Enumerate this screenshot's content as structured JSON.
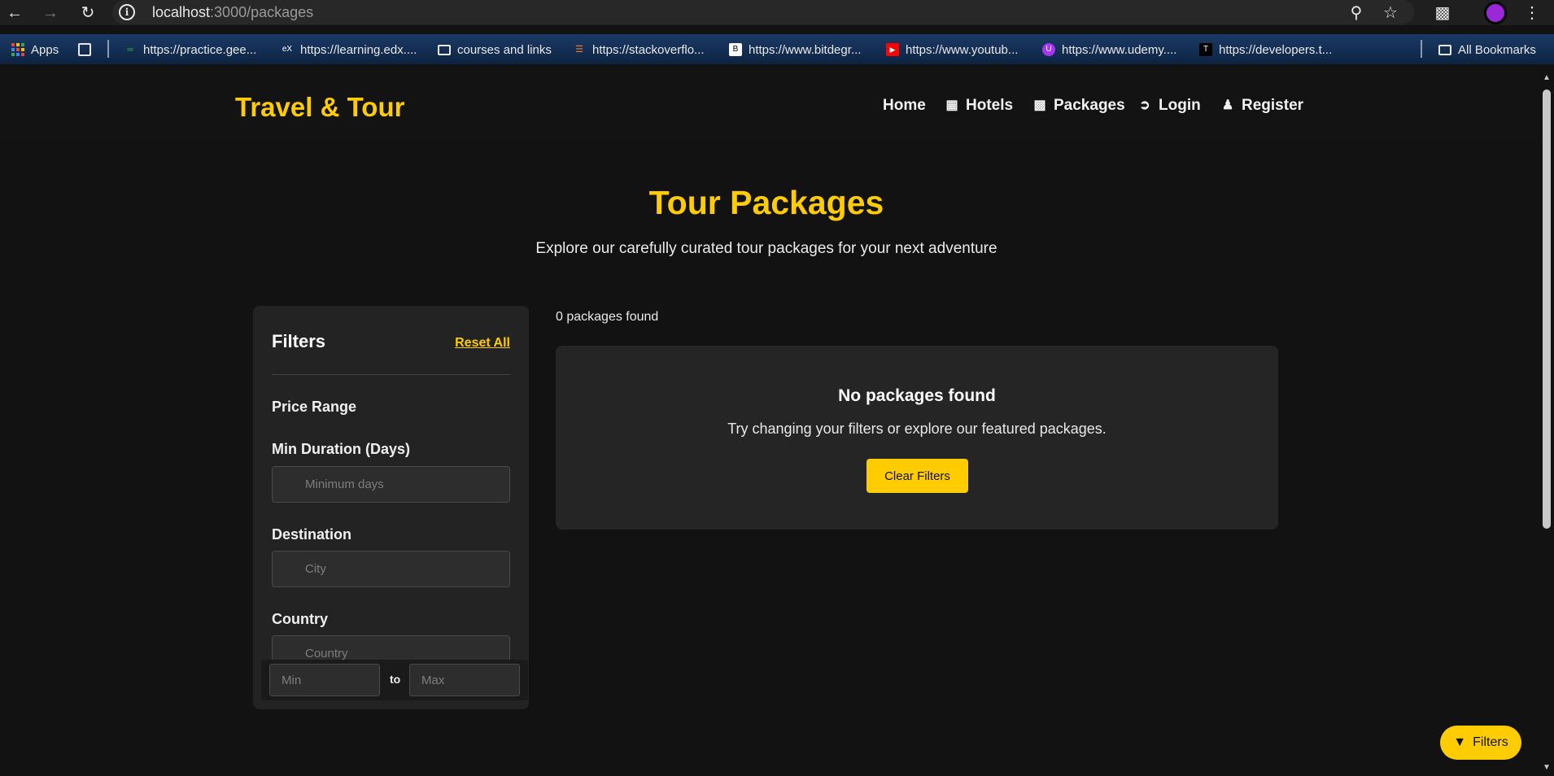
{
  "browser": {
    "url_host": "localhost",
    "url_path": ":3000/packages",
    "bookmarks": [
      {
        "label": "Apps"
      },
      {
        "label": "https://practice.gee..."
      },
      {
        "label": "https://learning.edx...."
      },
      {
        "label": "courses and links"
      },
      {
        "label": "https://stackoverflo..."
      },
      {
        "label": "https://www.bitdegr..."
      },
      {
        "label": "https://www.youtub..."
      },
      {
        "label": "https://www.udemy...."
      },
      {
        "label": "https://developers.t..."
      },
      {
        "label": "All Bookmarks"
      }
    ]
  },
  "site": {
    "brand": "Travel & Tour",
    "nav": [
      {
        "label": "Home",
        "icon": "none"
      },
      {
        "label": "Hotels",
        "icon": "building-icon"
      },
      {
        "label": "Packages",
        "icon": "suitcase-icon"
      },
      {
        "label": "Login",
        "icon": "sign-in-icon"
      },
      {
        "label": "Register",
        "icon": "user-plus-icon"
      }
    ]
  },
  "hero": {
    "title": "Tour Packages",
    "subtitle": "Explore our carefully curated tour packages for your next adventure"
  },
  "filters": {
    "title": "Filters",
    "reset_label": "Reset All",
    "price_label": "Price Range",
    "duration_label": "Min Duration (Days)",
    "duration_placeholder": "Minimum days",
    "destination_label": "Destination",
    "destination_placeholder": "City",
    "country_label": "Country",
    "country_placeholder": "Country",
    "min_placeholder": "Min",
    "to_label": "to",
    "max_placeholder": "Max"
  },
  "results": {
    "count_text": "0 packages found",
    "empty_title": "No packages found",
    "empty_sub": "Try changing your filters or explore our featured packages.",
    "clear_label": "Clear Filters"
  },
  "fab": {
    "label": "Filters"
  },
  "colors": {
    "accent": "#ffcc00",
    "background": "#121212",
    "card": "#252525"
  }
}
